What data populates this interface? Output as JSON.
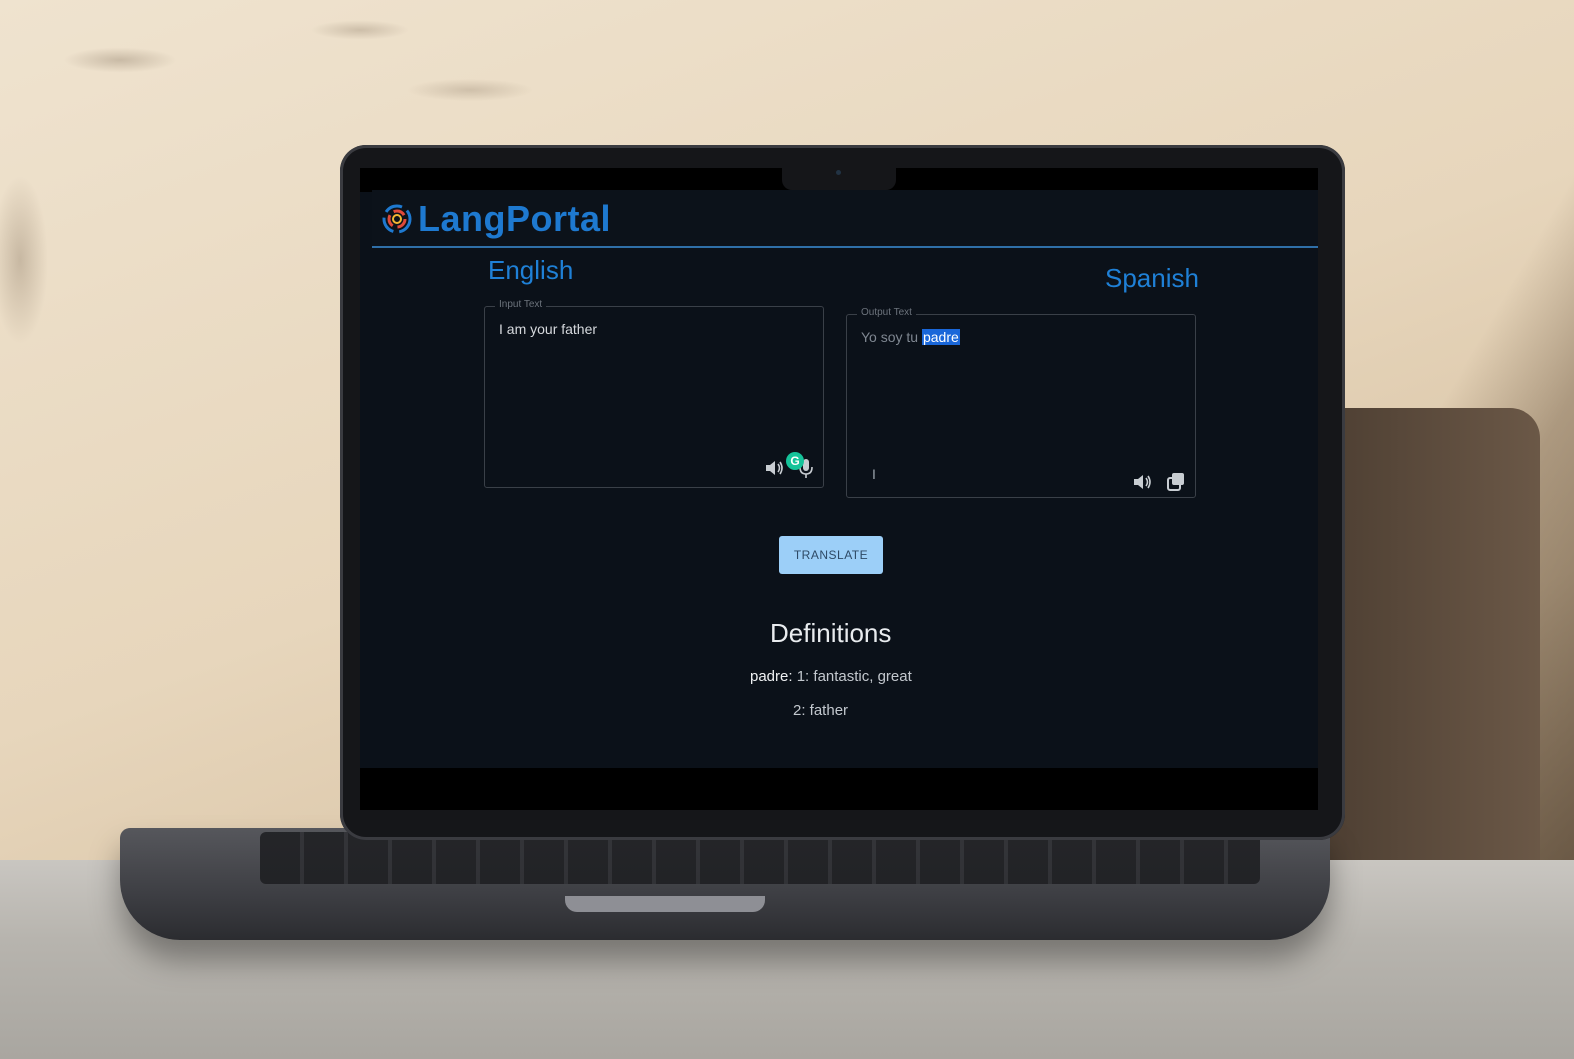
{
  "app": {
    "name": "LangPortal"
  },
  "languages": {
    "source": "English",
    "target": "Spanish"
  },
  "input": {
    "legend": "Input Text",
    "value": "I am your father"
  },
  "output": {
    "legend": "Output Text",
    "value_prefix": "Yo soy tu ",
    "value_selected": "padre"
  },
  "icons": {
    "speaker_src": "speaker-icon",
    "mic": "microphone-icon",
    "grammarly": "grammarly-icon",
    "grammarly_letter": "G",
    "speaker_tgt": "speaker-icon",
    "copy": "copy-icon"
  },
  "actions": {
    "translate_label": "TRANSLATE"
  },
  "definitions": {
    "title": "Definitions",
    "word": "padre:",
    "entry_1": "1: fantastic, great",
    "entry_2": "2: father"
  },
  "colors": {
    "accent": "#1e79d0",
    "button": "#9ccff8",
    "selection": "#1a67d9",
    "background": "#0b1119"
  }
}
